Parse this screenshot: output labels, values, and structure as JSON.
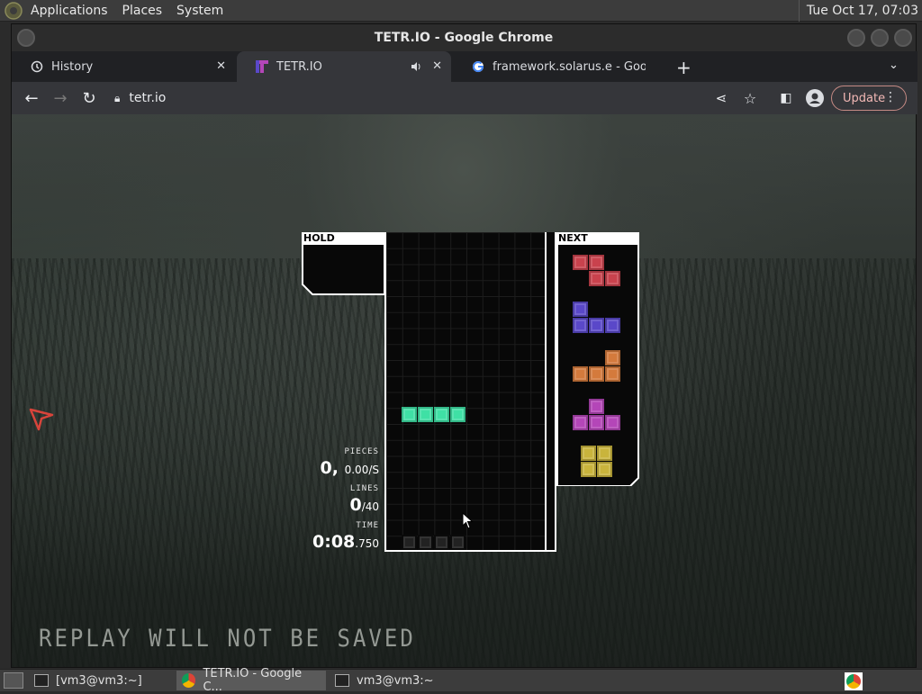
{
  "system_panel": {
    "menus": [
      "Applications",
      "Places",
      "System"
    ],
    "clock": "Tue Oct 17, 07:03"
  },
  "window": {
    "title": "TETR.IO - Google Chrome"
  },
  "tabs": [
    {
      "label": "History",
      "icon": "history-icon"
    },
    {
      "label": "TETR.IO",
      "icon": "tetrio-favicon",
      "active": true
    },
    {
      "label": "framework.solarus.e - Google",
      "icon": "google-icon"
    }
  ],
  "toolbar": {
    "url": "tetr.io",
    "update_label": "Update"
  },
  "game": {
    "hold_label": "HOLD",
    "next_label": "NEXT",
    "stats": {
      "pieces_label": "PIECES",
      "pieces_value": "0,",
      "pieces_rate": "0.00/S",
      "lines_label": "LINES",
      "lines_value": "0",
      "lines_goal": "/40",
      "time_label": "TIME",
      "time_value": "0:08",
      "time_ms": ".750"
    },
    "replay_notice": "REPLAY WILL NOT BE SAVED",
    "colors": {
      "I": "#3fe0a5",
      "Z": "#c9424d",
      "J": "#5a48c9",
      "L": "#d47a3c",
      "T": "#b446b8",
      "O": "#c9b43c"
    },
    "next_queue": [
      "Z",
      "J",
      "L",
      "T",
      "O"
    ],
    "active_piece": "I"
  },
  "taskbar": {
    "items": [
      {
        "label": "[vm3@vm3:~]"
      },
      {
        "label": "TETR.IO - Google C...",
        "active": true
      },
      {
        "label": "vm3@vm3:~"
      }
    ]
  }
}
